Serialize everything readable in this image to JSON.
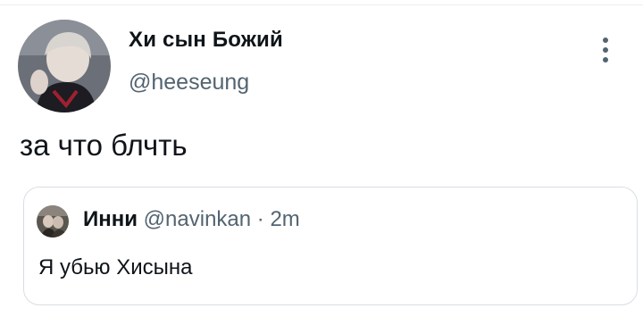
{
  "tweet": {
    "author_name": "Хи сын Божий",
    "author_handle": "@heeseung",
    "text": "за что блчть",
    "more_icon": "more-vertical-icon"
  },
  "quoted_tweet": {
    "author_name": "Инни",
    "author_handle": "@navinkan",
    "separator": "·",
    "time": "2m",
    "text": "Я убью Хисына"
  },
  "colors": {
    "primary_text": "#0f1419",
    "secondary_text": "#536471",
    "border": "#d9dee3"
  }
}
